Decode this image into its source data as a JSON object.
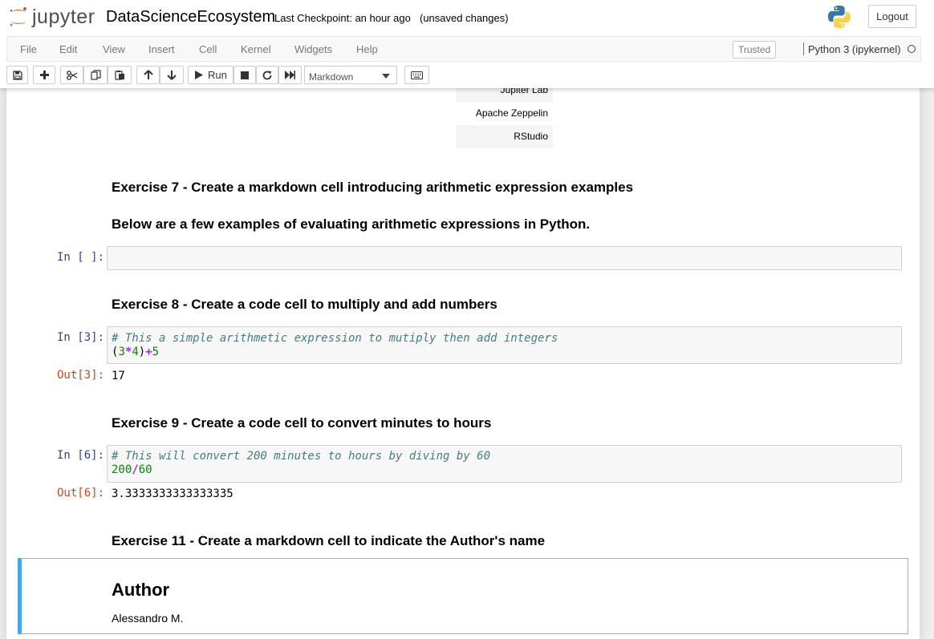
{
  "header": {
    "logo_text": "jupyter",
    "notebook_name": "DataScienceEcosystem",
    "checkpoint": "Last Checkpoint: an hour ago",
    "autosave": "(unsaved changes)",
    "logout_label": "Logout"
  },
  "menubar": {
    "items": [
      "File",
      "Edit",
      "View",
      "Insert",
      "Cell",
      "Kernel",
      "Widgets",
      "Help"
    ],
    "trusted_label": "Trusted",
    "kernel_name": "Python 3 (ipykernel)"
  },
  "toolbar": {
    "run_label": "Run",
    "cell_type_selected": "Markdown",
    "icons": [
      "save-icon",
      "plus-icon",
      "cut-icon",
      "copy-icon",
      "paste-icon",
      "arrow-up-icon",
      "arrow-down-icon",
      "run-icon",
      "stop-icon",
      "restart-icon",
      "fast-forward-icon",
      "keyboard-icon"
    ]
  },
  "notebook": {
    "table_rows": [
      "Jupiter Lab",
      "Apache Zeppelin",
      "RStudio"
    ],
    "ex7_heading": "Exercise 7 - Create a markdown cell introducing arithmetic expression examples",
    "ex7_subheading": "Below are a few examples of evaluating arithmetic expressions in Python.",
    "empty_prompt": "In [ ]:",
    "ex8_heading": "Exercise 8 - Create a code cell to multiply and add numbers",
    "cell3": {
      "in_prompt": "In [3]:",
      "comment": "# This a simple arithmetic expression to mutiply then add integers",
      "code": {
        "p1": "(",
        "n1": "3",
        "op1": "*",
        "n2": "4",
        "p2": ")",
        "op2": "+",
        "n3": "5"
      },
      "out_prompt": "Out[3]:",
      "output": "17"
    },
    "ex9_heading": "Exercise 9 - Create a code cell to convert minutes to hours",
    "cell6": {
      "in_prompt": "In [6]:",
      "comment": "# This will convert 200 minutes to hours by diving by 60",
      "code": {
        "n1": "200",
        "op": "/",
        "n2": "60"
      },
      "out_prompt": "Out[6]:",
      "output": "3.3333333333333335"
    },
    "ex11_heading": "Exercise 11 - Create a markdown cell to indicate the Author's name",
    "author_heading": "Author",
    "author_name": "Alessandro M."
  },
  "colors": {
    "prompt_in": "#303f9f",
    "prompt_out": "#d84315",
    "selected_markdown_border": "#42a5f5",
    "code_comment": "#408080",
    "code_number": "#008800",
    "code_operator": "#aa22ff"
  }
}
